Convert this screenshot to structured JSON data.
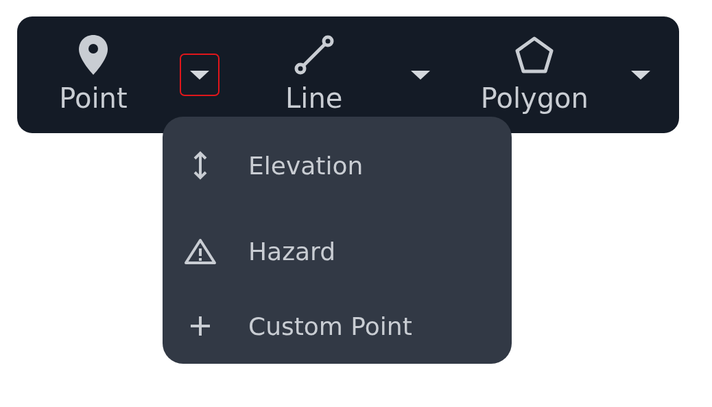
{
  "toolbar": {
    "tools": [
      {
        "kind": "pin",
        "label": "Point",
        "open": true
      },
      {
        "kind": "line",
        "label": "Line",
        "open": false
      },
      {
        "kind": "polygon",
        "label": "Polygon",
        "open": false
      }
    ]
  },
  "menu": {
    "items": [
      {
        "kind": "elevation",
        "label": "Elevation"
      },
      {
        "kind": "hazard",
        "label": "Hazard"
      },
      {
        "kind": "plus",
        "label": "Custom Point"
      }
    ]
  }
}
